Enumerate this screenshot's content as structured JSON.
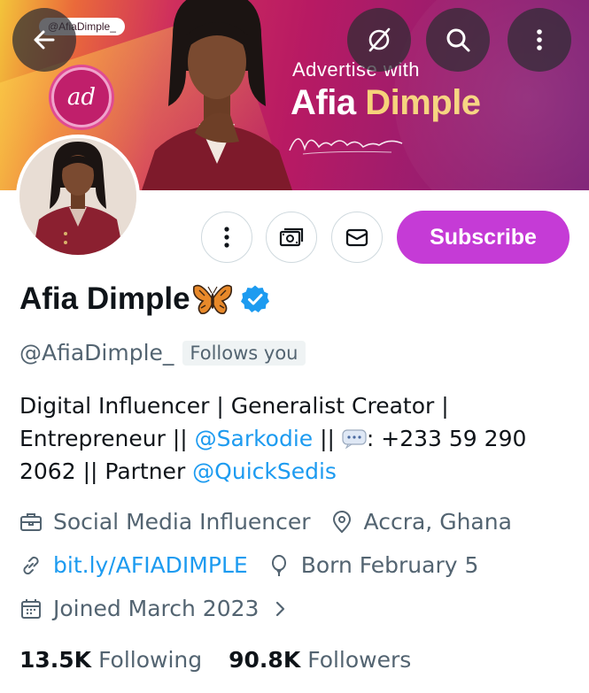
{
  "banner": {
    "handle_tag": "@AfiaDimple_",
    "logo_text": "ad",
    "ad_line1": "Advertise with",
    "ad_name_first": "Afia ",
    "ad_name_second": "Dimple"
  },
  "top_nav": {
    "back_icon": "arrow-left-icon",
    "grok_icon": "grok-icon",
    "search_icon": "search-icon",
    "more_icon": "more-vertical-icon"
  },
  "actions": {
    "more_icon": "more-vertical-icon",
    "tip_icon": "money-icon",
    "message_icon": "mail-icon",
    "subscribe_label": "Subscribe"
  },
  "profile": {
    "display_name": "Afia Dimple",
    "emoji": "butterfly",
    "verified": true,
    "handle": "@AfiaDimple_",
    "follows_you": "Follows you",
    "bio": {
      "part1": "Digital Influencer | Generalist Creator | Entrepreneur || ",
      "mention1": "@Sarkodie",
      "part2": " || ",
      "part3": ": +233 59 290 2062 || Partner ",
      "mention2": "@QuickSedis"
    },
    "category": "Social Media Influencer",
    "location": "Accra, Ghana",
    "website": "bit.ly/AFIADIMPLE",
    "birthday": "Born February 5",
    "joined": "Joined March 2023"
  },
  "stats": {
    "following_count": "13.5K",
    "following_label": "Following",
    "followers_count": "90.8K",
    "followers_label": "Followers"
  },
  "colors": {
    "subscribe": "#c53bd6",
    "link": "#1d9bf0",
    "muted": "#536471",
    "verified": "#1d9bf0"
  }
}
